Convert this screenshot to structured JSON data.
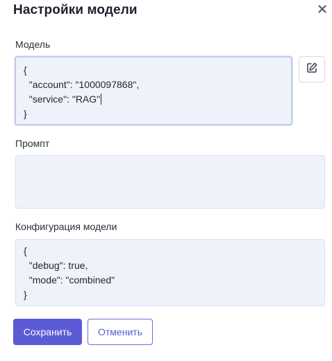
{
  "dialog": {
    "title": "Настройки модели",
    "close_icon": "close-icon"
  },
  "model": {
    "label": "Модель",
    "lines": [
      "{",
      "  \"account\": \"1000097868\",",
      "  \"service\": \"RAG\"",
      "}"
    ],
    "edit_icon": "edit-icon"
  },
  "prompt": {
    "label": "Промпт",
    "value": ""
  },
  "config": {
    "label": "Конфигурация модели",
    "lines": [
      "{",
      "  \"debug\": true,",
      "  \"mode\": \"combined\"",
      "}"
    ]
  },
  "actions": {
    "save_label": "Сохранить",
    "cancel_label": "Отменить"
  },
  "colors": {
    "primary": "#5b5bd6",
    "field_bg": "#eef2fb",
    "field_border": "#d9dfec",
    "focus_border": "#c3caea"
  }
}
